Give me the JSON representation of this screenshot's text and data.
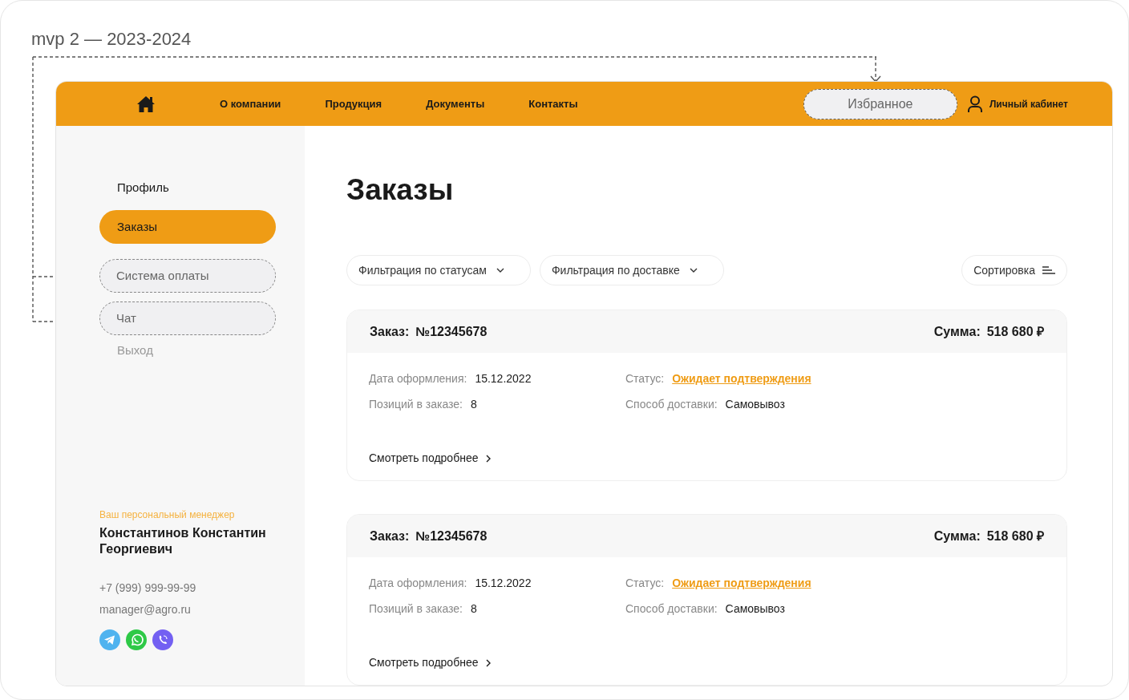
{
  "caption": "mvp 2 — 2023-2024",
  "nav": [
    {
      "kind": "home"
    },
    {
      "kind": "link",
      "label": "О компании"
    },
    {
      "kind": "link",
      "label": "Продукция"
    },
    {
      "kind": "link",
      "label": "Документы"
    },
    {
      "kind": "link",
      "label": "Контакты"
    }
  ],
  "favorites": {
    "label": "Избранное"
  },
  "account": {
    "label": "Личный кабинет"
  },
  "sidebar": {
    "items": [
      {
        "label": "Профиль",
        "kind": "link",
        "selected": false
      },
      {
        "label": "Заказы",
        "kind": "link",
        "selected": true
      },
      {
        "label": "Система оплаты",
        "kind": "draft",
        "selected": false
      },
      {
        "label": "Чат",
        "kind": "draft",
        "selected": false
      },
      {
        "label": "Выход",
        "kind": "exit",
        "selected": false
      }
    ]
  },
  "manager": {
    "caption": "Ваш персональный менеджер",
    "name": "Константинов Константин Георгиевич",
    "phone": "+7 (999) 999-99-99",
    "email": "manager@agro.ru",
    "messengers": [
      {
        "kind": "telegram"
      },
      {
        "kind": "whatsapp"
      },
      {
        "kind": "viber"
      }
    ]
  },
  "page_title": "Заказы",
  "filters": [
    {
      "label": "Фильтрация по статусам"
    },
    {
      "label": "Фильтрация по доставке"
    }
  ],
  "sort": {
    "label": "Сортировка"
  },
  "orders": [
    {
      "order_label": "Заказ:",
      "number": "№12345678",
      "sum_label": "Сумма:",
      "sum": "518 680 ₽",
      "date_label": "Дата оформления:",
      "date": "15.12.2022",
      "items_label": "Позиций в заказе:",
      "items": "8",
      "status_label": "Статус:",
      "status": "Ожидает подтверждения",
      "delivery_label": "Способ доставки:",
      "delivery": "Самовывоз",
      "more": "Смотреть подробнее"
    },
    {
      "order_label": "Заказ:",
      "number": "№12345678",
      "sum_label": "Сумма:",
      "sum": "518 680 ₽",
      "date_label": "Дата оформления:",
      "date": "15.12.2022",
      "items_label": "Позиций в заказе:",
      "items": "8",
      "status_label": "Статус:",
      "status": "Ожидает подтверждения",
      "delivery_label": "Способ доставки:",
      "delivery": "Самовывоз",
      "more": "Смотреть подробнее"
    }
  ]
}
